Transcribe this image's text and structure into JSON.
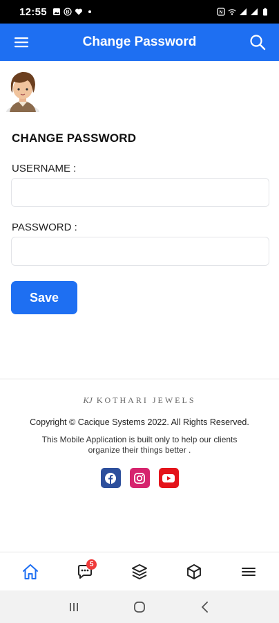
{
  "status_bar": {
    "time": "12:55",
    "left_icons": [
      "image-icon",
      "b-icon",
      "heart-icon",
      "dot-icon"
    ],
    "right_icons": [
      "nfc-icon",
      "wifi-icon",
      "signal-icon",
      "signal-icon",
      "battery-icon"
    ]
  },
  "header": {
    "title": "Change Password",
    "menu_icon": "hamburger-icon",
    "search_icon": "search-icon",
    "background": "#1e6ff2"
  },
  "form": {
    "title": "CHANGE PASSWORD",
    "username_label": "USERNAME :",
    "username_value": "",
    "username_placeholder": "",
    "password_label": "PASSWORD :",
    "password_value": "",
    "password_placeholder": "",
    "save_label": "Save"
  },
  "footer": {
    "brand_mark": "KJ",
    "brand_name": "KOTHARI JEWELS",
    "copyright": "Copyright © Cacique Systems 2022. All Rights Reserved.",
    "note": "This Mobile Application is built only to help our clients organize their things better .",
    "social": [
      {
        "name": "facebook",
        "color": "#2d4f9c"
      },
      {
        "name": "instagram",
        "color": "#d6246e"
      },
      {
        "name": "youtube",
        "color": "#e4141b"
      }
    ]
  },
  "bottom_nav": {
    "items": [
      "home-icon",
      "chat-icon",
      "layers-icon",
      "box-icon",
      "menu-icon"
    ],
    "active": "home-icon",
    "chat_badge": "5",
    "accent": "#1e6ff2"
  },
  "system_nav": [
    "recents-icon",
    "home-circle-icon",
    "back-icon"
  ]
}
